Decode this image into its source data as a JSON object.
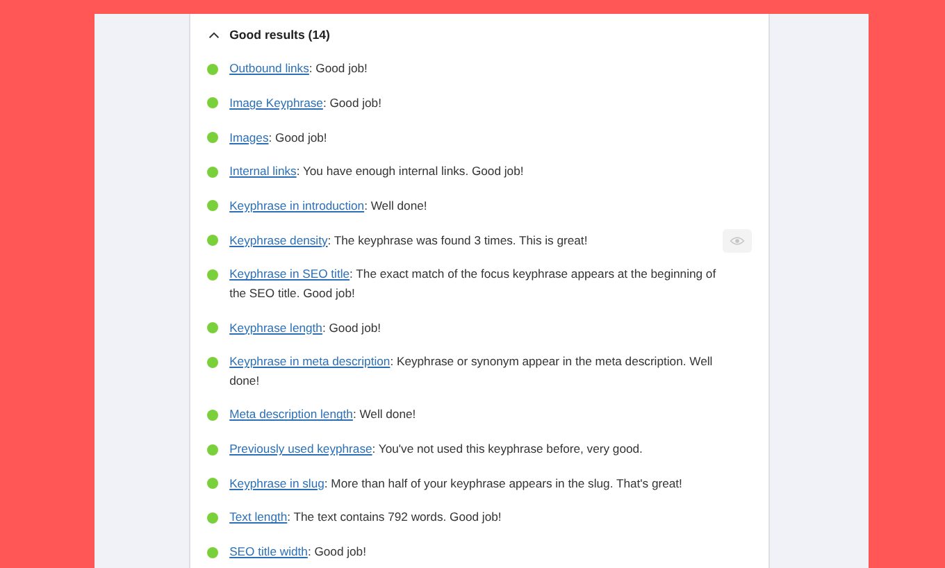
{
  "section": {
    "title": "Good results (14)",
    "expanded": true
  },
  "results": [
    {
      "link": "Outbound links",
      "text": ": Good job!",
      "color": "#7ad03a",
      "highlight_button": false
    },
    {
      "link": "Image Keyphrase",
      "text": ": Good job!",
      "color": "#7ad03a",
      "highlight_button": false
    },
    {
      "link": "Images",
      "text": ": Good job!",
      "color": "#7ad03a",
      "highlight_button": false
    },
    {
      "link": "Internal links",
      "text": ": You have enough internal links. Good job!",
      "color": "#7ad03a",
      "highlight_button": false
    },
    {
      "link": "Keyphrase in introduction",
      "text": ": Well done!",
      "color": "#7ad03a",
      "highlight_button": false
    },
    {
      "link": "Keyphrase density",
      "text": ": The keyphrase was found 3 times. This is great!",
      "color": "#7ad03a",
      "highlight_button": true
    },
    {
      "link": "Keyphrase in SEO title",
      "text": ": The exact match of the focus keyphrase appears at the beginning of the SEO title. Good job!",
      "color": "#7ad03a",
      "highlight_button": false
    },
    {
      "link": "Keyphrase length",
      "text": ": Good job!",
      "color": "#7ad03a",
      "highlight_button": false
    },
    {
      "link": "Keyphrase in meta description",
      "text": ": Keyphrase or synonym appear in the meta description. Well done!",
      "color": "#7ad03a",
      "highlight_button": false
    },
    {
      "link": "Meta description length",
      "text": ": Well done!",
      "color": "#7ad03a",
      "highlight_button": false
    },
    {
      "link": "Previously used keyphrase",
      "text": ": You've not used this keyphrase before, very good.",
      "color": "#7ad03a",
      "highlight_button": false
    },
    {
      "link": "Keyphrase in slug",
      "text": ": More than half of your keyphrase appears in the slug. That's great!",
      "color": "#7ad03a",
      "highlight_button": false
    },
    {
      "link": "Text length",
      "text": ": The text contains 792 words. Good job!",
      "color": "#7ad03a",
      "highlight_button": false
    },
    {
      "link": "SEO title width",
      "text": ": Good job!",
      "color": "#7ad03a",
      "highlight_button": false
    }
  ]
}
